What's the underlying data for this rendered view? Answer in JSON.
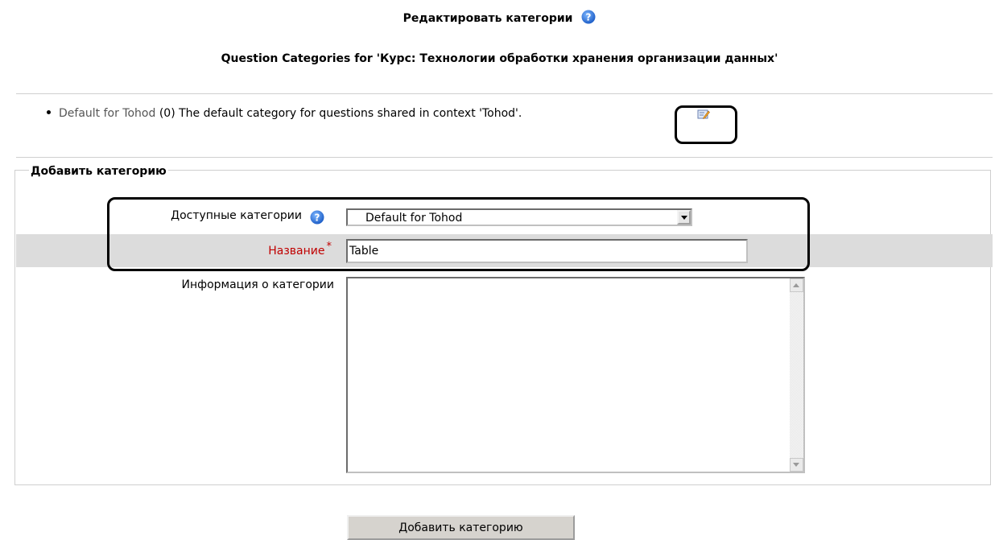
{
  "page": {
    "title": "Редактировать категории",
    "subtitle": "Question Categories for 'Курс: Технологии обработки хранения организации данных'"
  },
  "category_list": {
    "items": [
      {
        "name": "Default for Tohod",
        "count": "(0)",
        "description": "The default category for questions shared in context 'Tohod'."
      }
    ]
  },
  "add_category": {
    "legend": "Добавить категорию",
    "parent_label": "Доступные категории",
    "parent_value": "Default for Tohod",
    "name_label": "Название",
    "required_marker": "*",
    "name_value": "Table",
    "info_label": "Информация о категории",
    "info_value": "",
    "submit_label": "Добавить категорию"
  },
  "colors": {
    "required": "#c00000",
    "help_icon": "#1e6fd6",
    "row_highlight": "#dcdcdc"
  },
  "icons": [
    "help-icon",
    "edit-icon"
  ]
}
